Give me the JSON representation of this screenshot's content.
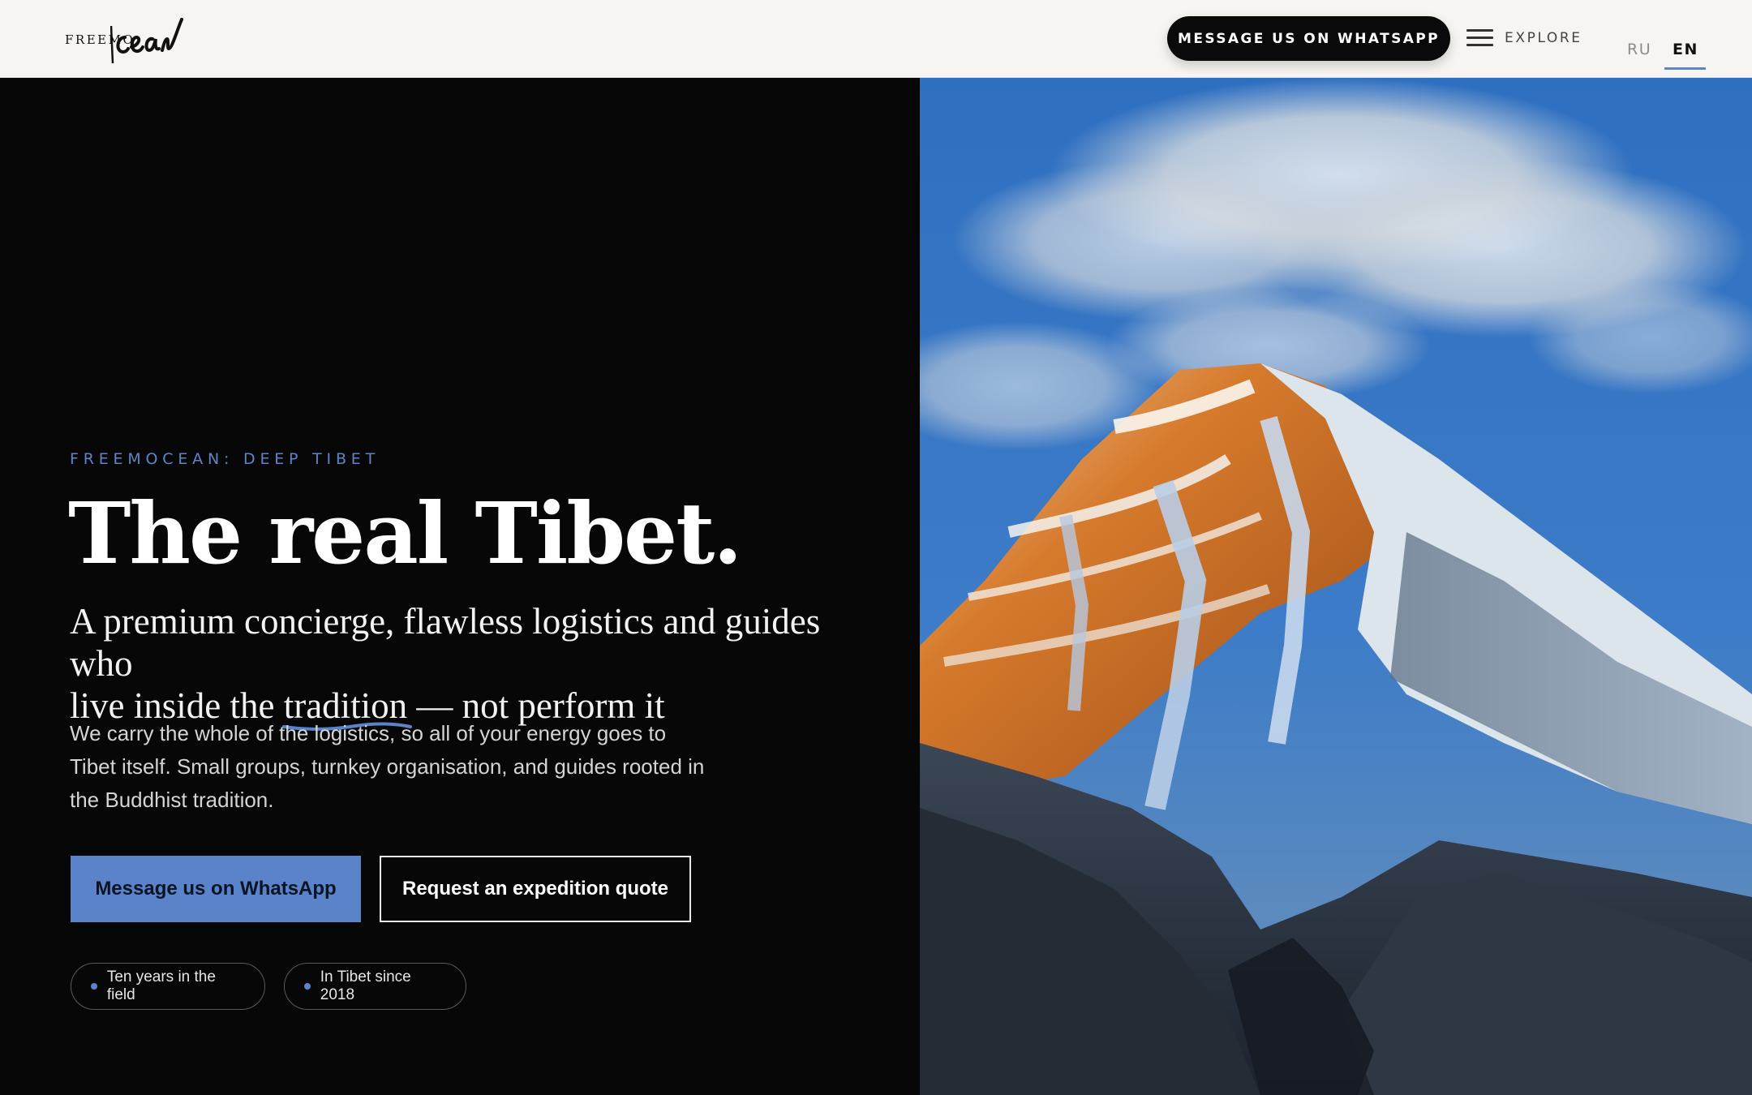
{
  "header": {
    "logo": {
      "small_text": "FREEMO",
      "script_text": "cean"
    },
    "whatsapp_button": "MESSAGE US ON WHATSAPP",
    "explore_label": "EXPLORE",
    "languages": [
      "RU",
      "EN"
    ],
    "active_language": "EN"
  },
  "hero": {
    "eyebrow": "FREEMOCEAN: DEEP TIBET",
    "title": "The real Tibet.",
    "subtitle_line1": "A premium concierge, flawless logistics and guides who",
    "subtitle_line2_before": "live inside the ",
    "subtitle_highlight": "tradition",
    "subtitle_line2_after": " — not perform it",
    "body": "We carry the whole of the logistics, so all of your energy goes to Tibet itself. Small groups, turnkey organisation, and guides rooted in the Buddhist tradition.",
    "primary_button": "Message us on WhatsApp",
    "secondary_button": "Request an expedition quote",
    "badges": [
      "Ten years in the field",
      "In Tibet since 2018"
    ]
  },
  "photo": {
    "subject": "sunlit snow-capped mountain peak under blue sky with clouds"
  },
  "colors": {
    "accent": "#5a83c9",
    "header_bg": "#f7f5f1",
    "hero_bg": "#070707",
    "whatsapp_button_bg": "#0a0a0a"
  },
  "icons": {
    "menu": "hamburger-menu-icon",
    "badge_bullet": "dot-icon"
  }
}
